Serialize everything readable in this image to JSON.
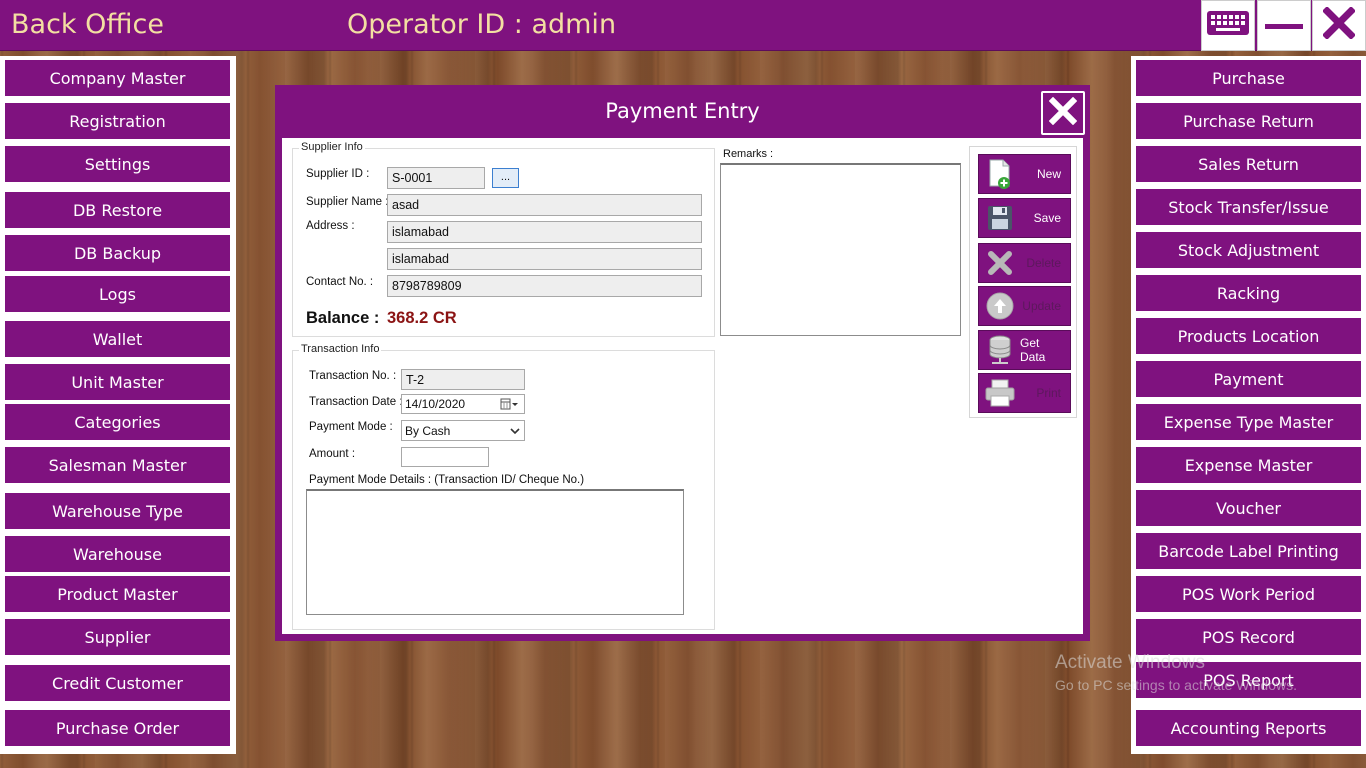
{
  "header": {
    "app_title": "Back Office",
    "operator_label": "Operator ID :  admin"
  },
  "window_controls": {
    "keyboard_icon": "keyboard-icon",
    "minimize_icon": "minimize-icon",
    "close_icon": "close-icon"
  },
  "left_menu": [
    {
      "label": "Company Master"
    },
    {
      "label": "Registration"
    },
    {
      "label": "Settings"
    },
    {
      "label": "DB Restore"
    },
    {
      "label": "DB Backup"
    },
    {
      "label": "Logs"
    },
    {
      "label": "Wallet"
    },
    {
      "label": "Unit Master"
    },
    {
      "label": "Categories"
    },
    {
      "label": "Salesman Master"
    },
    {
      "label": "Warehouse Type"
    },
    {
      "label": "Warehouse"
    },
    {
      "label": "Product Master"
    },
    {
      "label": "Supplier"
    },
    {
      "label": "Credit Customer"
    },
    {
      "label": "Purchase Order"
    }
  ],
  "right_menu": [
    {
      "label": "Purchase"
    },
    {
      "label": "Purchase Return"
    },
    {
      "label": "Sales Return"
    },
    {
      "label": "Stock Transfer/Issue"
    },
    {
      "label": "Stock Adjustment"
    },
    {
      "label": "Racking"
    },
    {
      "label": "Products Location"
    },
    {
      "label": "Payment"
    },
    {
      "label": "Expense Type Master"
    },
    {
      "label": "Expense Master"
    },
    {
      "label": "Voucher"
    },
    {
      "label": "Barcode Label Printing"
    },
    {
      "label": "POS Work Period"
    },
    {
      "label": "POS Record"
    },
    {
      "label": "POS Report"
    },
    {
      "label": "Accounting Reports"
    }
  ],
  "dialog": {
    "title": "Payment Entry",
    "supplier_info": {
      "legend": "Supplier Info",
      "supplier_id_label": "Supplier ID :",
      "supplier_id_value": "S-0001",
      "browse_label": "...",
      "supplier_name_label": "Supplier Name :",
      "supplier_name_value": "asad",
      "address_label": "Address :",
      "address_line1": "islamabad",
      "address_line2": "islamabad",
      "contact_label": "Contact No. :",
      "contact_value": "8798789809",
      "balance_label": "Balance :",
      "balance_value": "368.2 CR"
    },
    "remarks": {
      "label": "Remarks :",
      "value": ""
    },
    "transaction_info": {
      "legend": "Transaction Info",
      "transaction_no_label": "Transaction No. :",
      "transaction_no_value": "T-2",
      "transaction_date_label": "Transaction Date :",
      "transaction_date_value": "14/10/2020",
      "payment_mode_label": "Payment Mode :",
      "payment_mode_value": "By Cash",
      "amount_label": "Amount :",
      "amount_value": "",
      "details_label": "Payment Mode Details : (Transaction ID/ Cheque No.)",
      "details_value": ""
    },
    "actions": [
      {
        "label": "New",
        "icon": "new-document-icon",
        "enabled": true
      },
      {
        "label": "Save",
        "icon": "floppy-disk-icon",
        "enabled": true
      },
      {
        "label": "Delete",
        "icon": "delete-x-icon",
        "enabled": false
      },
      {
        "label": "Update",
        "icon": "upload-arrow-icon",
        "enabled": false
      },
      {
        "label": "Get Data",
        "icon": "database-icon",
        "enabled": true
      },
      {
        "label": "Print",
        "icon": "printer-icon",
        "enabled": false
      }
    ]
  },
  "watermark": {
    "line1": "Activate Windows",
    "line2": "Go to PC settings to activate Windows."
  },
  "colors": {
    "brand_purple": "#7f127f",
    "title_gold": "#f3dfa2",
    "balance_red": "#8b1414"
  }
}
